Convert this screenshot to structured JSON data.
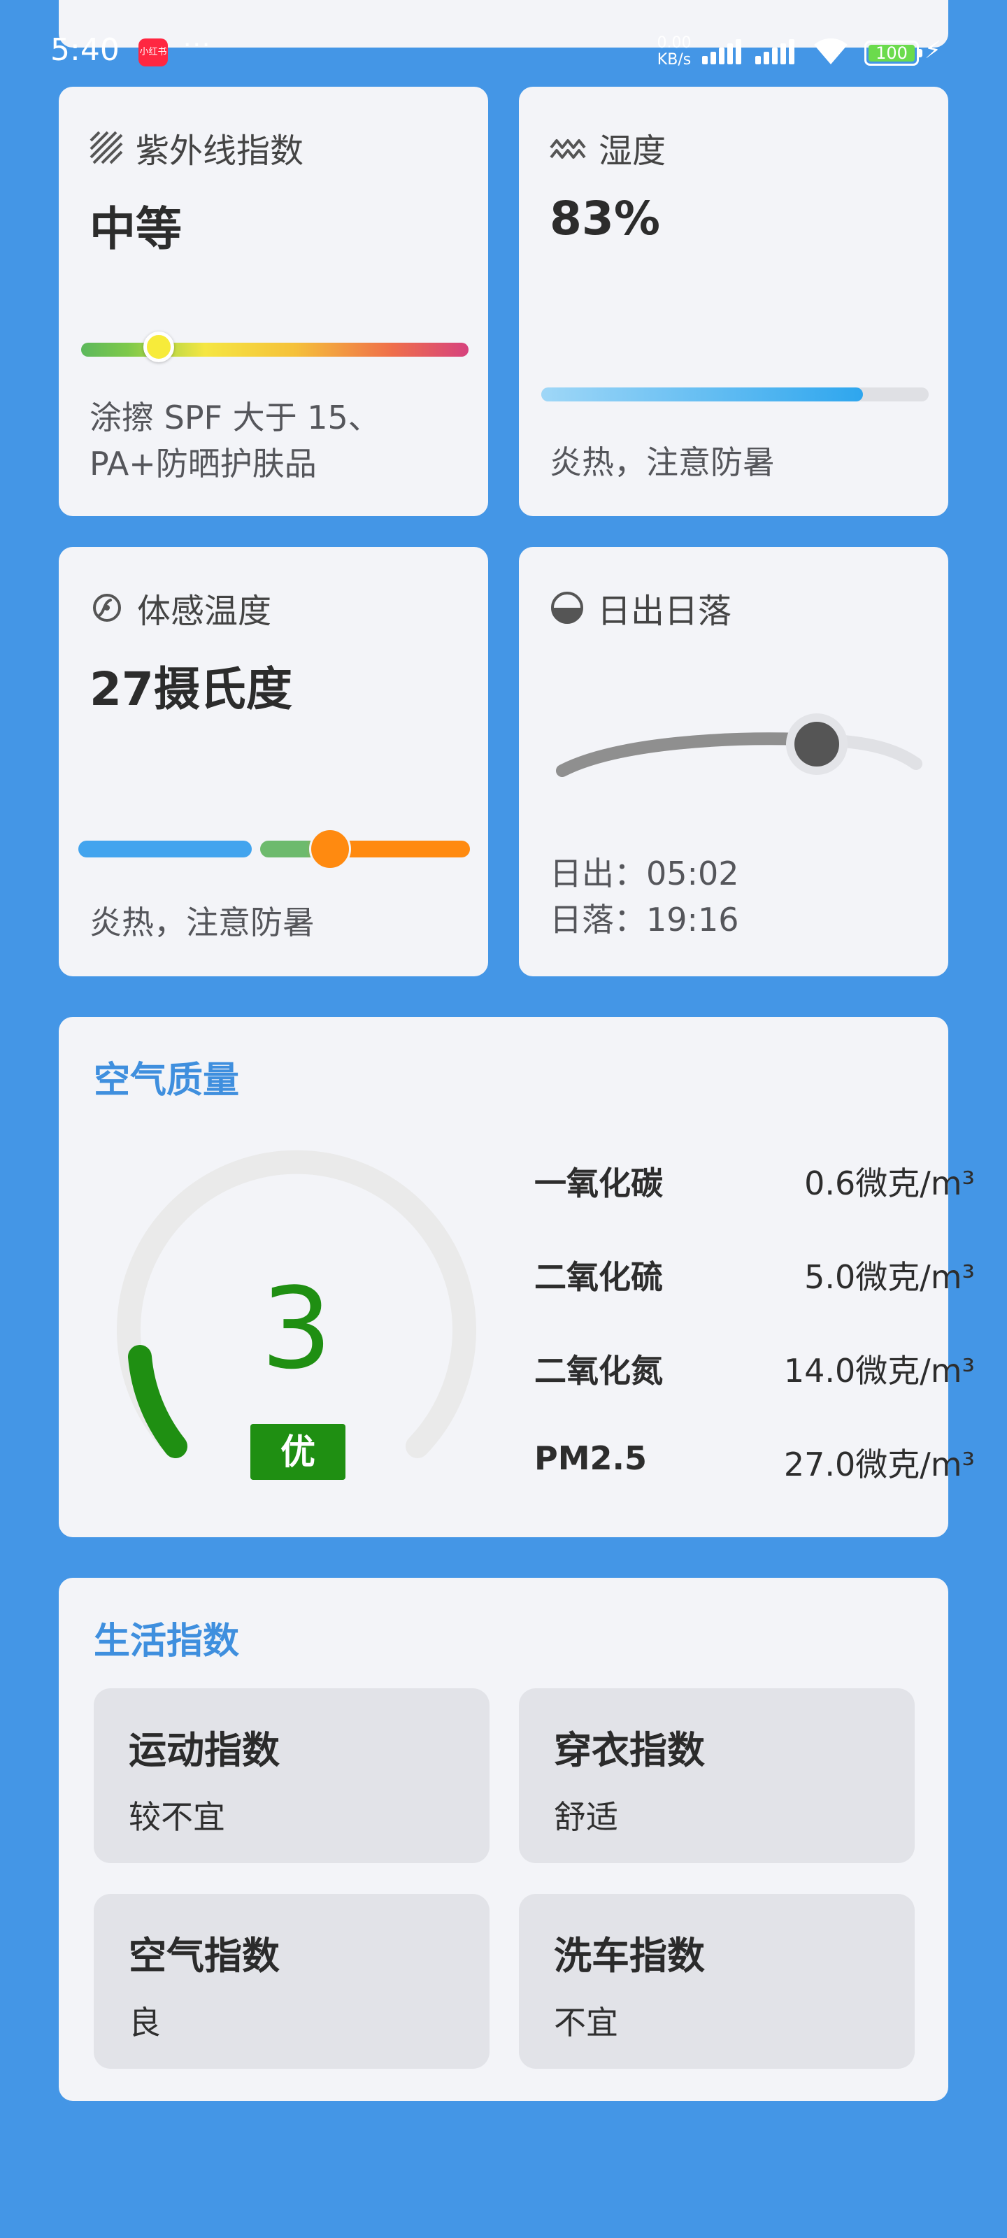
{
  "status_bar": {
    "time": "5:40",
    "app_icon_text": "小红书",
    "dots": "···",
    "net_speed_value": "0.00",
    "net_speed_unit": "KB/s",
    "battery": "100"
  },
  "uv": {
    "title": "紫外线指数",
    "icon": "hatch-icon",
    "value": "中等",
    "level": 0.2,
    "desc_line1": "涂擦 SPF 大于 15、",
    "desc_line2": "PA+防晒护肤品"
  },
  "humidity": {
    "title": "湿度",
    "icon": "wave-icon",
    "value": "83%",
    "level": 0.83,
    "desc": "炎热，注意防暑"
  },
  "feels_like": {
    "title": "体感温度",
    "icon": "thermo-icon",
    "value": "27摄氏度",
    "desc": "炎热，注意防暑"
  },
  "sun": {
    "title": "日出日落",
    "icon": "half-circle-icon",
    "sunrise": "日出：05:02",
    "sunset": "日落：19:16"
  },
  "air_quality": {
    "title": "空气质量",
    "aqi": "3",
    "level_label": "优",
    "accent": "#1f8f12",
    "pollutants": [
      {
        "name": "一氧化碳",
        "value": "0.6微克/m³"
      },
      {
        "name": "二氧化硫",
        "value": "5.0微克/m³"
      },
      {
        "name": "二氧化氮",
        "value": "14.0微克/m³"
      },
      {
        "name": "PM2.5",
        "value": "27.0微克/m³"
      }
    ]
  },
  "life_index": {
    "title": "生活指数",
    "items": [
      {
        "name": "运动指数",
        "value": "较不宜"
      },
      {
        "name": "穿衣指数",
        "value": "舒适"
      },
      {
        "name": "空气指数",
        "value": "良"
      },
      {
        "name": "洗车指数",
        "value": "不宜"
      }
    ]
  }
}
